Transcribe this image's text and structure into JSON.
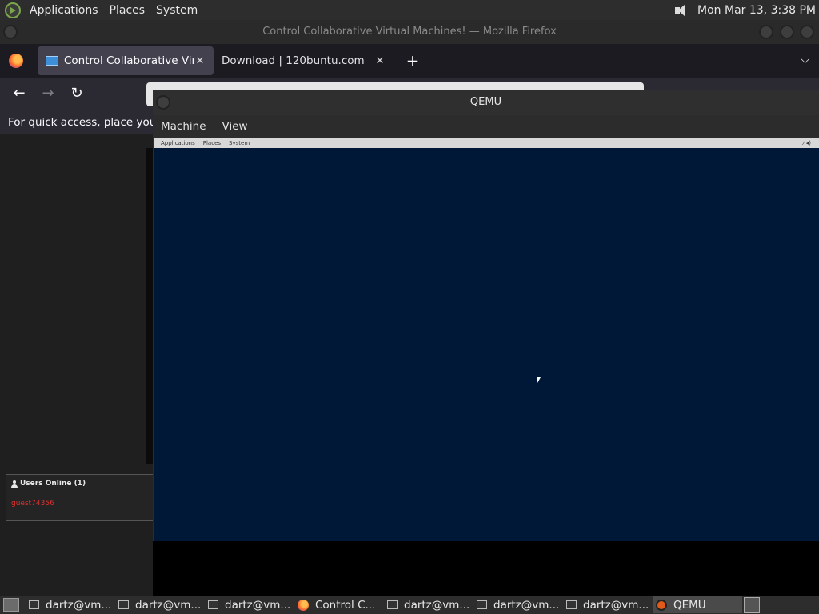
{
  "top_panel": {
    "menus": [
      "Applications",
      "Places",
      "System"
    ],
    "clock": "Mon Mar 13,  3:38 PM"
  },
  "firefox": {
    "window_title": "Control Collaborative Virtual Machines! — Mozilla Firefox",
    "tabs": [
      {
        "label": "Control Collaborative Virtual Machines!",
        "active": true
      },
      {
        "label": "Download | 120buntu.com",
        "active": false
      }
    ],
    "bookmarks_hint": "For quick access, place your bookmarks here on the bookmarks toolbar."
  },
  "page": {
    "users_online_title": "Users Online (1)",
    "users": [
      "guest74356"
    ]
  },
  "qemu": {
    "title": "QEMU",
    "menus": [
      "Machine",
      "View"
    ],
    "guest_panel_menus": [
      "Applications",
      "Places",
      "System"
    ]
  },
  "taskbar": {
    "items": [
      {
        "label": "dartz@vm...",
        "icon": "terminal-icon"
      },
      {
        "label": "dartz@vm...",
        "icon": "terminal-icon"
      },
      {
        "label": "dartz@vm...",
        "icon": "terminal-icon"
      },
      {
        "label": "Control C...",
        "icon": "firefox-icon"
      },
      {
        "label": "dartz@vm...",
        "icon": "terminal-icon"
      },
      {
        "label": "dartz@vm...",
        "icon": "terminal-icon"
      },
      {
        "label": "dartz@vm...",
        "icon": "terminal-icon"
      },
      {
        "label": "QEMU",
        "icon": "qemu-icon",
        "active": true
      }
    ]
  }
}
